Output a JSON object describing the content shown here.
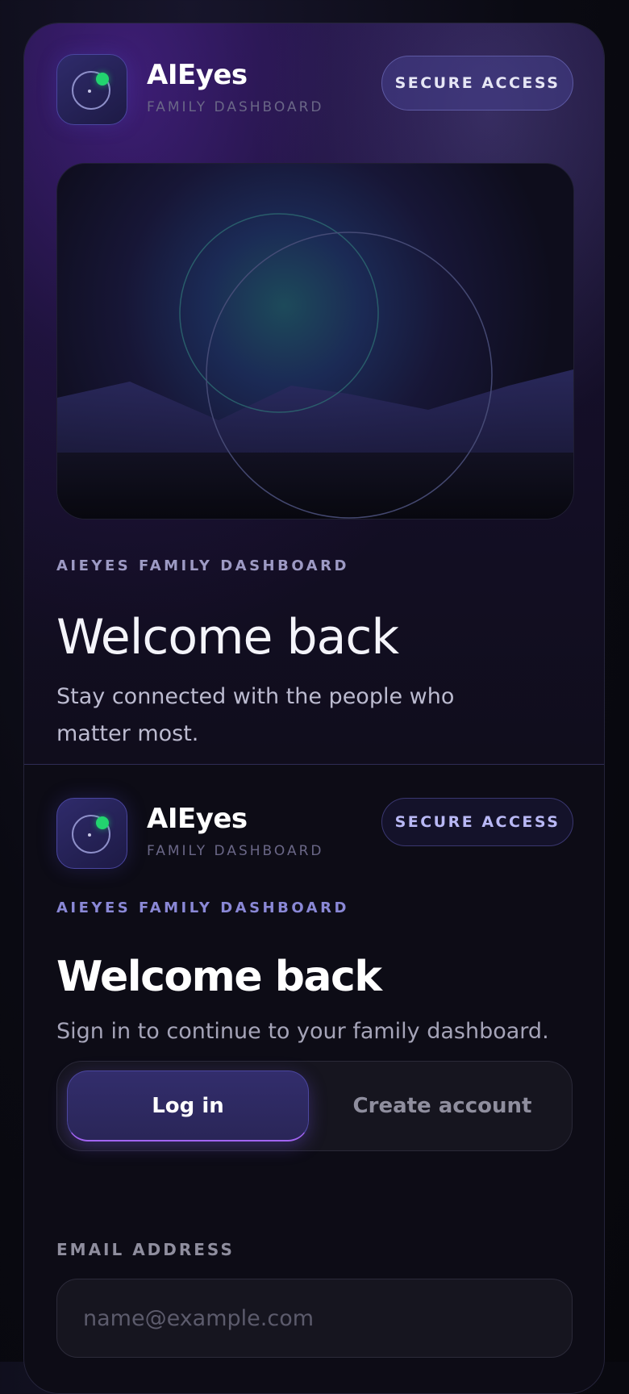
{
  "brand": {
    "name": "AIEyes",
    "subtitle": "FAMILY DASHBOARD",
    "secure_label": "SECURE ACCESS"
  },
  "hero": {
    "eyebrow": "AIEYES FAMILY DASHBOARD",
    "title": "Welcome back",
    "subtitle": "Stay connected with the people who matter most."
  },
  "form": {
    "eyebrow": "AIEYES FAMILY DASHBOARD",
    "title": "Welcome back",
    "subtitle": "Sign in to continue to your family dashboard.",
    "tabs": [
      {
        "label": "Log in",
        "active": true
      },
      {
        "label": "Create account",
        "active": false
      }
    ],
    "email": {
      "label": "EMAIL ADDRESS",
      "value": "",
      "placeholder": "name@example.com"
    }
  },
  "colors": {
    "accent": "#a264f2",
    "status_dot": "#22d46f",
    "background": "#0d0c16"
  },
  "icons": {
    "logo": "eye-lens-icon"
  }
}
